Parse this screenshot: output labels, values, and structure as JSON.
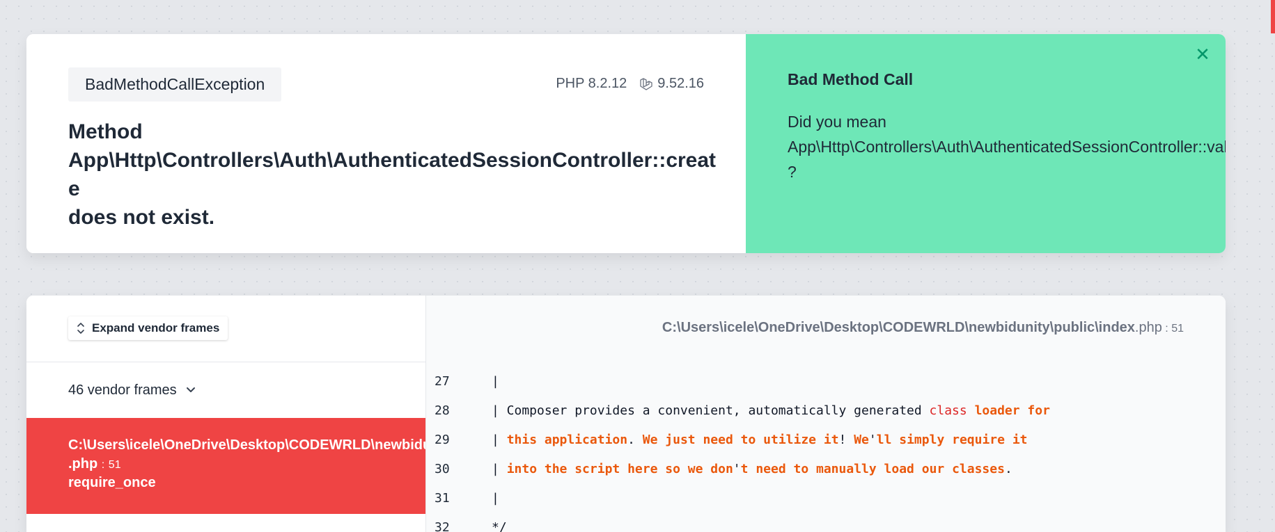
{
  "exception": {
    "class": "BadMethodCallException",
    "php_version": "PHP 8.2.12",
    "laravel_version": "9.52.16",
    "message_line1": "Method",
    "message_line2": "App\\Http\\Controllers\\Auth\\AuthenticatedSessionController::create",
    "message_line3": "does not exist."
  },
  "solution": {
    "title": "Bad Method Call",
    "line1": "Did you mean",
    "line2": "App\\Http\\Controllers\\Auth\\AuthenticatedSessionController::valid",
    "line3": "?",
    "close_icon": "close-icon",
    "accent": "#6ee7b7"
  },
  "frames": {
    "expand_label": "Expand vendor frames",
    "vendor_count_label": "46 vendor frames",
    "active": {
      "path": "C:\\Users\\icele\\OneDrive\\Desktop\\CODEWRLD\\newbidunity\\public\\index",
      "file": ".php",
      "line_sep": ":",
      "line": "51",
      "method": "require_once",
      "color": "#ef4444"
    }
  },
  "code": {
    "path_dir": "C:\\Users\\icele\\OneDrive\\Desktop\\CODEWRLD\\newbidunity\\public\\index",
    "path_ext": ".php",
    "path_sep": " : ",
    "path_line": "51",
    "lines": [
      {
        "num": "27",
        "text": "|"
      },
      {
        "num": "28",
        "text": "| Composer provides a convenient, automatically generated ",
        "red": "class",
        "sp": " ",
        "orange": "loader for"
      },
      {
        "num": "29",
        "text": "| ",
        "orange": "this application",
        "p1": ". ",
        "orange2": "We just need to utilize it",
        "p2": "! ",
        "orange3": "We",
        "p3": "'",
        "orange4": "ll simply require it"
      },
      {
        "num": "30",
        "text": "| ",
        "orange": "into the script here so we don",
        "p1": "'",
        "orange2": "t need to manually load our classes",
        "p2": "."
      },
      {
        "num": "31",
        "text": "|"
      },
      {
        "num": "32",
        "text": "*/"
      }
    ]
  }
}
